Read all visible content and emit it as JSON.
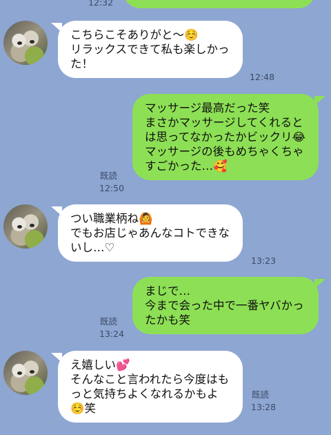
{
  "messages": [
    {
      "side": "left",
      "text": "こちらこそありがと〜☺️\nリラックスできて私も楽しかった！",
      "time": "12:48"
    },
    {
      "side": "right",
      "text": "マッサージ最高だった笑\nまさかマッサージしてくれるとは思ってなかったかビックリ😂\nマッサージの後もめちゃくちゃすごかった…🥰",
      "read": "既読",
      "time": "12:50"
    },
    {
      "side": "left",
      "text": "つい職業柄ね🙆\nでもお店じゃあんなコトできないし…♡",
      "time": "13:23"
    },
    {
      "side": "right",
      "text": "まじで…\n今まで会った中で一番ヤバかったかも笑",
      "read": "既読",
      "time": "13:24"
    },
    {
      "side": "left",
      "text": "え嬉しい💕\nそんなこと言われたら今度はもっと気持ちよくなれるかもよ☺️笑",
      "read": "既読",
      "time": "13:28"
    }
  ],
  "top_partial": {
    "time": "12:32"
  }
}
